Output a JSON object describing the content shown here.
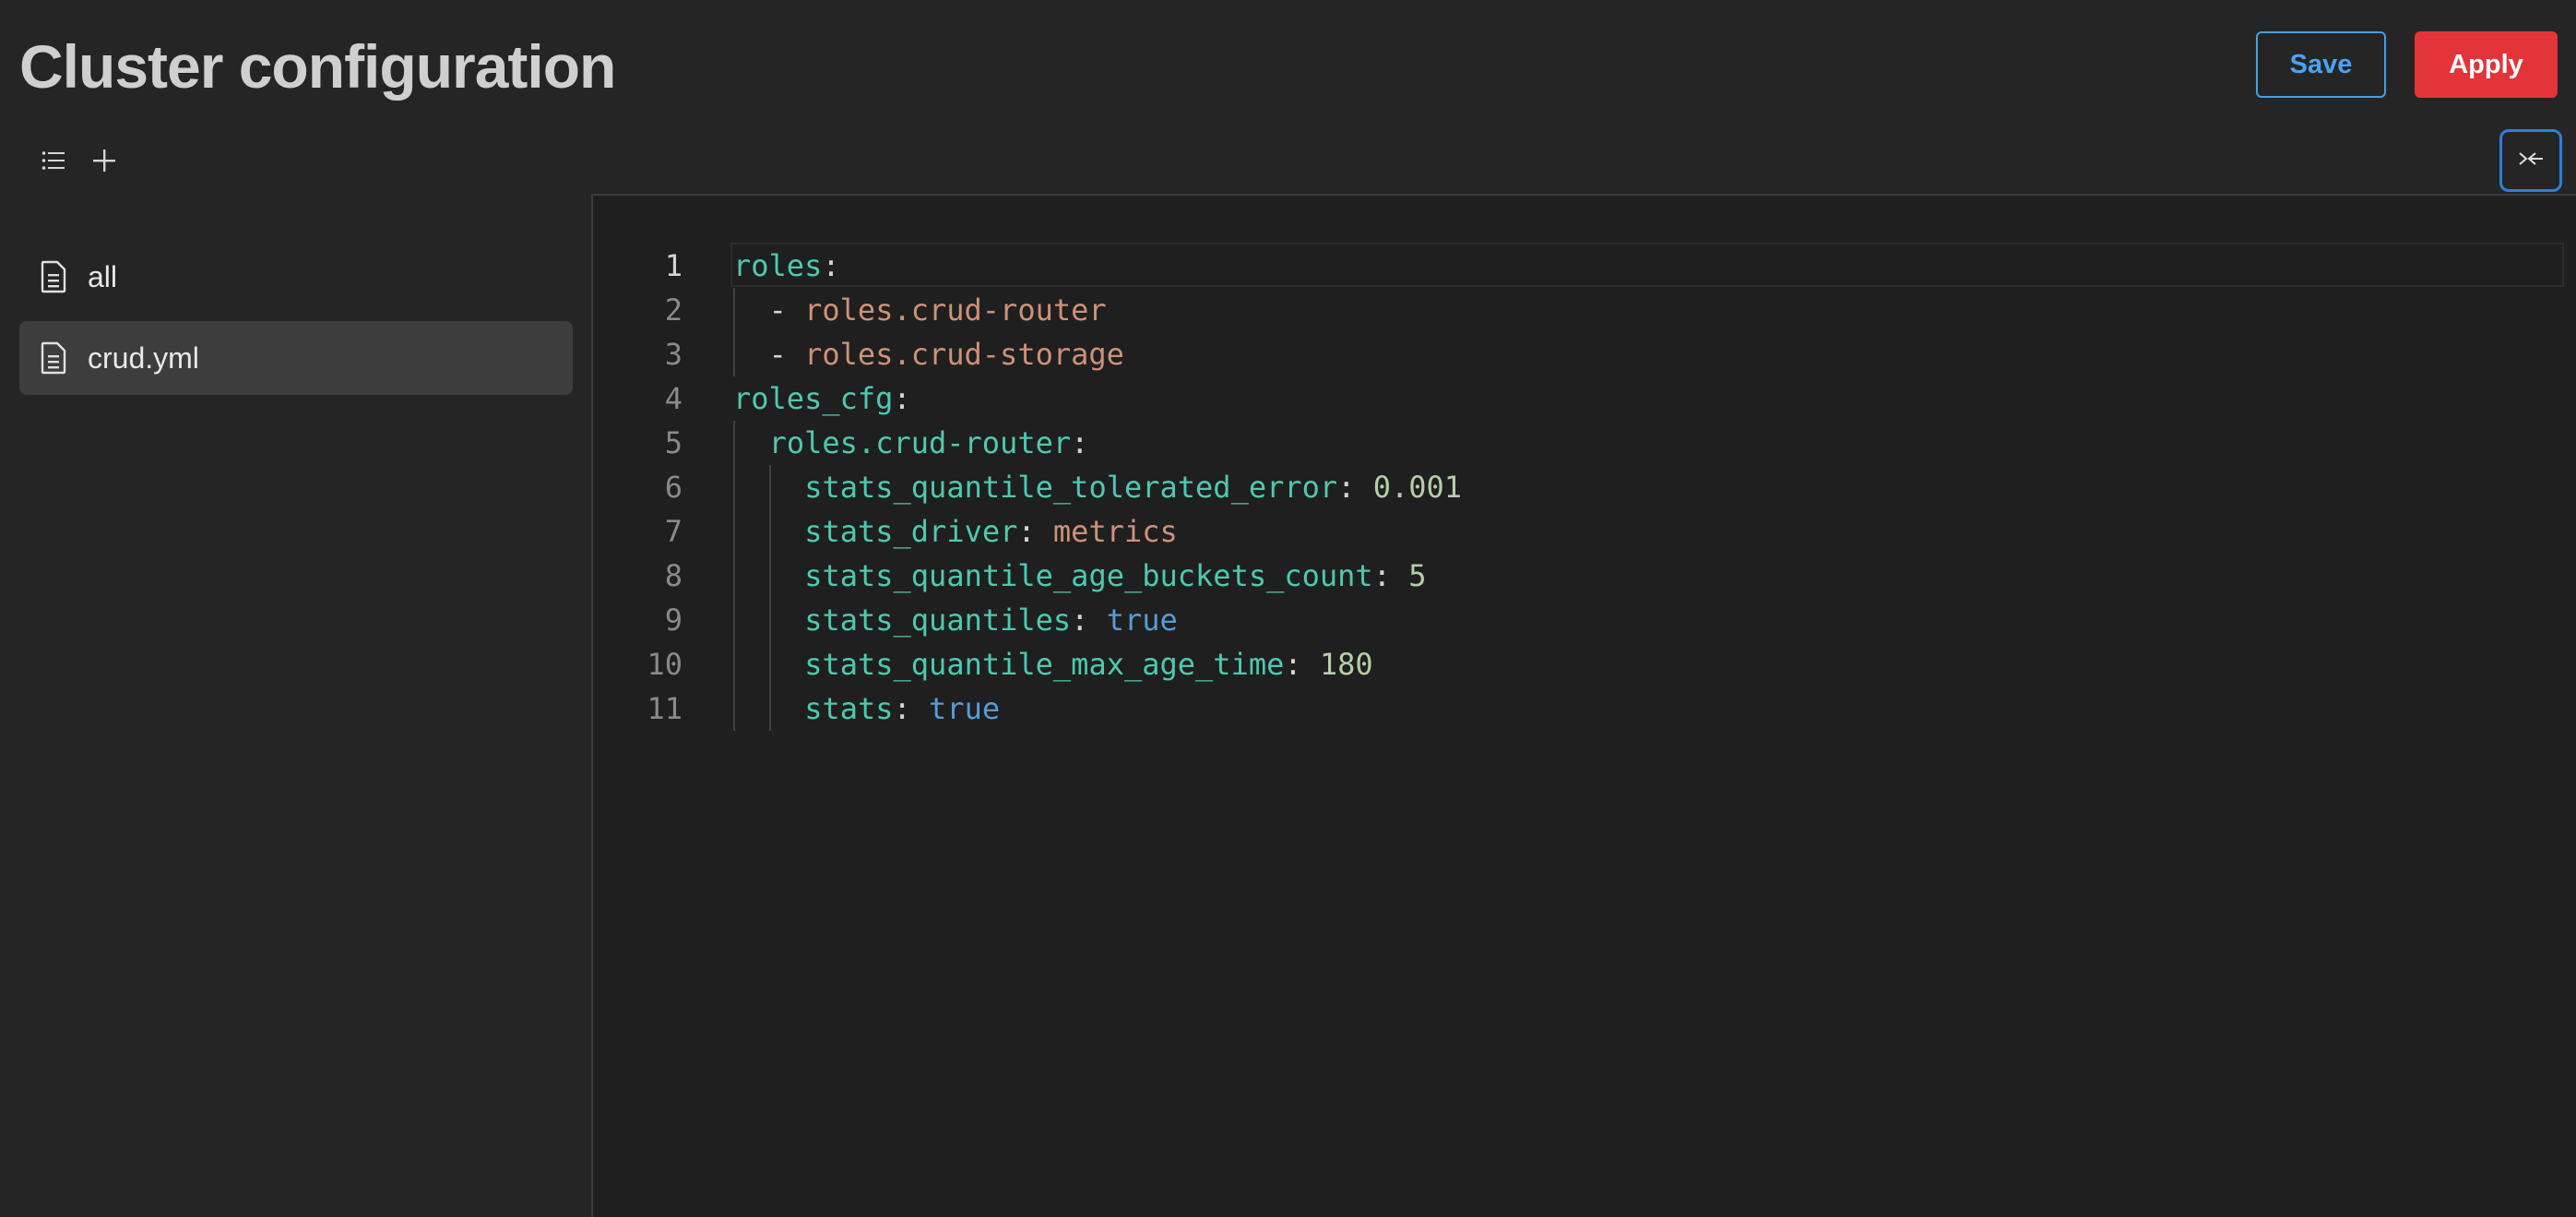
{
  "header": {
    "title": "Cluster configuration",
    "save_label": "Save",
    "apply_label": "Apply"
  },
  "toolbar": {
    "list_icon": "list-icon",
    "add_icon": "plus-icon",
    "toggle_icon": "collapse-panel-icon"
  },
  "sidebar": {
    "files": [
      {
        "label": "all",
        "icon": "file-icon",
        "selected": false
      },
      {
        "label": "crud.yml",
        "icon": "file-icon",
        "selected": true
      }
    ]
  },
  "editor": {
    "file": "crud.yml",
    "lines": [
      {
        "num": "1",
        "indent": 0,
        "tokens": [
          {
            "t": "roles",
            "c": "k"
          },
          {
            "t": ":",
            "c": "p"
          }
        ]
      },
      {
        "num": "2",
        "indent": 1,
        "tokens": [
          {
            "t": "- ",
            "c": "p"
          },
          {
            "t": "roles.crud-router",
            "c": "s"
          }
        ]
      },
      {
        "num": "3",
        "indent": 1,
        "tokens": [
          {
            "t": "- ",
            "c": "p"
          },
          {
            "t": "roles.crud-storage",
            "c": "s"
          }
        ]
      },
      {
        "num": "4",
        "indent": 0,
        "tokens": [
          {
            "t": "roles_cfg",
            "c": "k"
          },
          {
            "t": ":",
            "c": "p"
          }
        ]
      },
      {
        "num": "5",
        "indent": 1,
        "tokens": [
          {
            "t": "roles.crud-router",
            "c": "k"
          },
          {
            "t": ":",
            "c": "p"
          }
        ]
      },
      {
        "num": "6",
        "indent": 2,
        "tokens": [
          {
            "t": "stats_quantile_tolerated_error",
            "c": "k"
          },
          {
            "t": ": ",
            "c": "p"
          },
          {
            "t": "0.001",
            "c": "n"
          }
        ]
      },
      {
        "num": "7",
        "indent": 2,
        "tokens": [
          {
            "t": "stats_driver",
            "c": "k"
          },
          {
            "t": ": ",
            "c": "p"
          },
          {
            "t": "metrics",
            "c": "s"
          }
        ]
      },
      {
        "num": "8",
        "indent": 2,
        "tokens": [
          {
            "t": "stats_quantile_age_buckets_count",
            "c": "k"
          },
          {
            "t": ": ",
            "c": "p"
          },
          {
            "t": "5",
            "c": "n"
          }
        ]
      },
      {
        "num": "9",
        "indent": 2,
        "tokens": [
          {
            "t": "stats_quantiles",
            "c": "k"
          },
          {
            "t": ": ",
            "c": "p"
          },
          {
            "t": "true",
            "c": "b"
          }
        ]
      },
      {
        "num": "10",
        "indent": 2,
        "tokens": [
          {
            "t": "stats_quantile_max_age_time",
            "c": "k"
          },
          {
            "t": ": ",
            "c": "p"
          },
          {
            "t": "180",
            "c": "n"
          }
        ]
      },
      {
        "num": "11",
        "indent": 2,
        "tokens": [
          {
            "t": "stats",
            "c": "k"
          },
          {
            "t": ": ",
            "c": "p"
          },
          {
            "t": "true",
            "c": "b"
          }
        ]
      }
    ]
  },
  "colors": {
    "accent": "#4aa3f0",
    "danger": "#e3343a",
    "key": "#4ec9b0",
    "string": "#ce9178",
    "number": "#b5cea8",
    "boolean": "#569cd6"
  }
}
